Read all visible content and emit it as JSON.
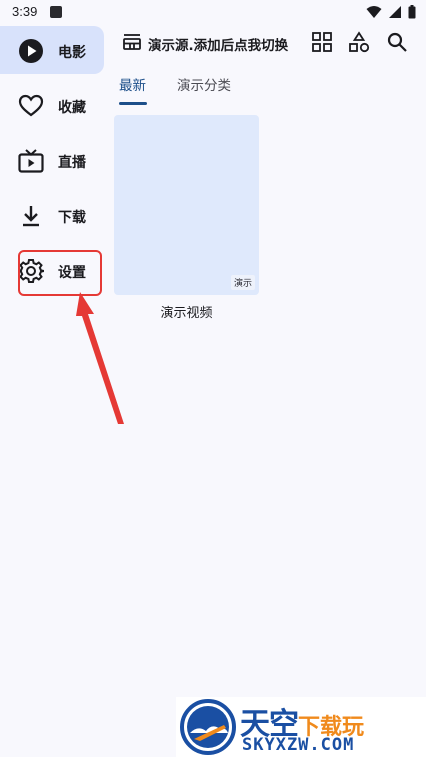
{
  "status_bar": {
    "time": "3:39"
  },
  "sidebar": {
    "items": [
      {
        "label": "电影",
        "icon": "play-circle-icon",
        "active": true
      },
      {
        "label": "收藏",
        "icon": "heart-icon",
        "active": false
      },
      {
        "label": "直播",
        "icon": "tv-icon",
        "active": false
      },
      {
        "label": "下载",
        "icon": "download-icon",
        "active": false
      },
      {
        "label": "设置",
        "icon": "gear-icon",
        "active": false
      }
    ]
  },
  "top_bar": {
    "source_title": "演示源.添加后点我切换",
    "actions": [
      "grid-view-icon",
      "shapes-icon",
      "search-icon"
    ]
  },
  "tabs": [
    {
      "label": "最新",
      "active": true
    },
    {
      "label": "演示分类",
      "active": false
    }
  ],
  "videos": [
    {
      "title": "演示视频",
      "badge": "演示"
    }
  ],
  "watermark": {
    "main_blue": "天空",
    "main_orange": "下载玩",
    "domain": "SKYXZW.COM"
  },
  "colors": {
    "background": "#f8f8fd",
    "active_nav": "#d8e2fb",
    "accent": "#1d4f8a",
    "thumbnail": "#dfe9fc",
    "annotation": "#e53935"
  }
}
